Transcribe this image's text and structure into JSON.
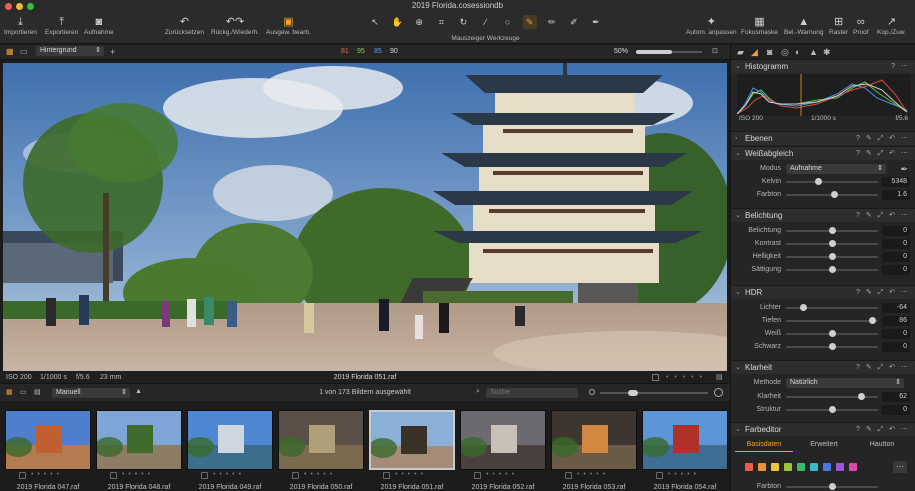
{
  "window": {
    "title": "2019 Florida.cosessiondb"
  },
  "toolbar": {
    "left_buttons": [
      {
        "icon": "import-icon",
        "glyph": "⤓",
        "label": "Importieren"
      },
      {
        "icon": "export-icon",
        "glyph": "⤒",
        "label": "Exportieren"
      },
      {
        "icon": "camera-icon",
        "glyph": "◙",
        "label": "Aufnahme"
      }
    ],
    "mid_buttons": [
      {
        "icon": "reset-icon",
        "glyph": "↶",
        "label": "Zurücksetzen"
      },
      {
        "icon": "undo-redo-icon",
        "glyph": "↶↷",
        "label": "Rückg./Wiederh."
      },
      {
        "icon": "copy-adjustments-icon",
        "glyph": "▣",
        "label": "Ausgew. bearb."
      }
    ],
    "cursor_tools_label": "Mauszeiger Werkzeuge",
    "cursor_tools": [
      "↖",
      "✋",
      "⊕",
      "⌗",
      "↻",
      "∕",
      "○",
      "✎",
      "✏",
      "✐",
      "✒"
    ],
    "right_buttons": [
      {
        "icon": "auto-adjust-icon",
        "glyph": "✦",
        "label": "Autom. anpassen"
      },
      {
        "icon": "focus-mask-icon",
        "glyph": "▦",
        "label": "Fokusmaske"
      },
      {
        "icon": "exposure-warning-icon",
        "glyph": "▲",
        "label": "Bel.-Warnung"
      },
      {
        "icon": "grid-icon",
        "glyph": "⊞",
        "label": "Raster"
      },
      {
        "icon": "proof-icon",
        "glyph": "∞",
        "label": "Proof"
      },
      {
        "icon": "copy-apply-icon",
        "glyph": "↗",
        "label": "Kop./Zuw."
      }
    ]
  },
  "subbar": {
    "layer": "Hintergrund",
    "rgb": {
      "r": "81",
      "g": "95",
      "b": "85",
      "l": "90"
    },
    "zoom": "50%"
  },
  "viewer": {
    "info_left": [
      "ISO 200",
      "1/1000 s",
      "f/5.6",
      "23 mm"
    ],
    "filename": "2019 Florida 051.raf"
  },
  "browser": {
    "sort": "Manuell",
    "count": "1 von 173 Bildern ausgewählt",
    "search_placeholder": "Suche"
  },
  "thumbnails": [
    {
      "name": "2019 Florida 047.raf",
      "sky": "#4f7ecb",
      "ground": "#b27b52",
      "accent": "#c06030"
    },
    {
      "name": "2019 Florida 048.raf",
      "sky": "#7da6d6",
      "ground": "#8f7c64",
      "accent": "#3e6b2c"
    },
    {
      "name": "2019 Florida 049.raf",
      "sky": "#4e88d2",
      "ground": "#3b6d8c",
      "accent": "#d0d6df"
    },
    {
      "name": "2019 Florida 050.raf",
      "sky": "#5a5048",
      "ground": "#7a6a50",
      "accent": "#b0a07a"
    },
    {
      "name": "2019 Florida 051.raf",
      "sky": "#8ab0d8",
      "ground": "#a48c78",
      "accent": "#3a3228",
      "selected": true
    },
    {
      "name": "2019 Florida 052.raf",
      "sky": "#6c6a70",
      "ground": "#4a4040",
      "accent": "#c9c0b8"
    },
    {
      "name": "2019 Florida 053.raf",
      "sky": "#3e3530",
      "ground": "#6a5a48",
      "accent": "#d08840"
    },
    {
      "name": "2019 Florida 054.raf",
      "sky": "#5d95d8",
      "ground": "#3f6e94",
      "accent": "#b0302a"
    }
  ],
  "panel": {
    "histogram": {
      "title": "Histogramm",
      "iso": "ISO 200",
      "shutter": "1/1000 s",
      "aperture": "f/5.6"
    },
    "ebenen": {
      "title": "Ebenen"
    },
    "weissabgleich": {
      "title": "Weißabgleich",
      "modus_label": "Modus",
      "modus_value": "Aufnahme",
      "rows": [
        {
          "label": "Kelvin",
          "value": "5348",
          "pos": 0.35
        },
        {
          "label": "Farbton",
          "value": "1.6",
          "pos": 0.52
        }
      ]
    },
    "belichtung": {
      "title": "Belichtung",
      "rows": [
        {
          "label": "Belichtung",
          "value": "0",
          "pos": 0.5
        },
        {
          "label": "Kontrast",
          "value": "0",
          "pos": 0.5
        },
        {
          "label": "Helligkeit",
          "value": "0",
          "pos": 0.5
        },
        {
          "label": "Sättigung",
          "value": "0",
          "pos": 0.5
        }
      ]
    },
    "hdr": {
      "title": "HDR",
      "rows": [
        {
          "label": "Lichter",
          "value": "-64",
          "pos": 0.18
        },
        {
          "label": "Tiefen",
          "value": "86",
          "pos": 0.93
        },
        {
          "label": "Weiß",
          "value": "0",
          "pos": 0.5
        },
        {
          "label": "Schwarz",
          "value": "0",
          "pos": 0.5
        }
      ]
    },
    "klarheit": {
      "title": "Klarheit",
      "methode_label": "Methode",
      "methode_value": "Natürlich",
      "rows": [
        {
          "label": "Klarheit",
          "value": "62",
          "pos": 0.81
        },
        {
          "label": "Struktur",
          "value": "0",
          "pos": 0.5
        }
      ]
    },
    "farbeditor": {
      "title": "Farbeditor",
      "tabs": [
        "Basisdaten",
        "Erweitert",
        "Hautton"
      ],
      "swatches": [
        "#e8604a",
        "#e8903a",
        "#e8c83a",
        "#98c83a",
        "#3ab868",
        "#3ab8c8",
        "#4a78e0",
        "#9a58d8",
        "#d84aa8"
      ],
      "farbton_label": "Farbton"
    },
    "accent": "#f0a030"
  }
}
